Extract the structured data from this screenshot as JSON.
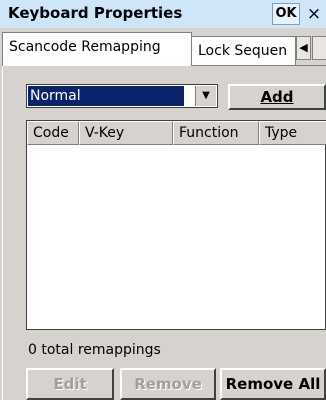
{
  "window": {
    "title": "Keyboard Properties",
    "ok_label": "OK",
    "close_glyph": "×"
  },
  "tabs": [
    {
      "label": "Scancode Remapping",
      "active": true
    },
    {
      "label": "Lock Sequen",
      "active": false
    }
  ],
  "tab_scroll_glyph": "◀",
  "mode_select": {
    "value": "Normal"
  },
  "add_button": {
    "label": "Add"
  },
  "list": {
    "columns": [
      "Code",
      "V-Key",
      "Function",
      "Type"
    ],
    "rows": []
  },
  "status": {
    "total_text": "0 total remappings"
  },
  "buttons": {
    "edit": "Edit",
    "remove": "Remove",
    "remove_all": "Remove All"
  },
  "colors": {
    "titlebar": "#cfe6f8",
    "selection": "#0a246a",
    "face": "#d6d3ce"
  }
}
